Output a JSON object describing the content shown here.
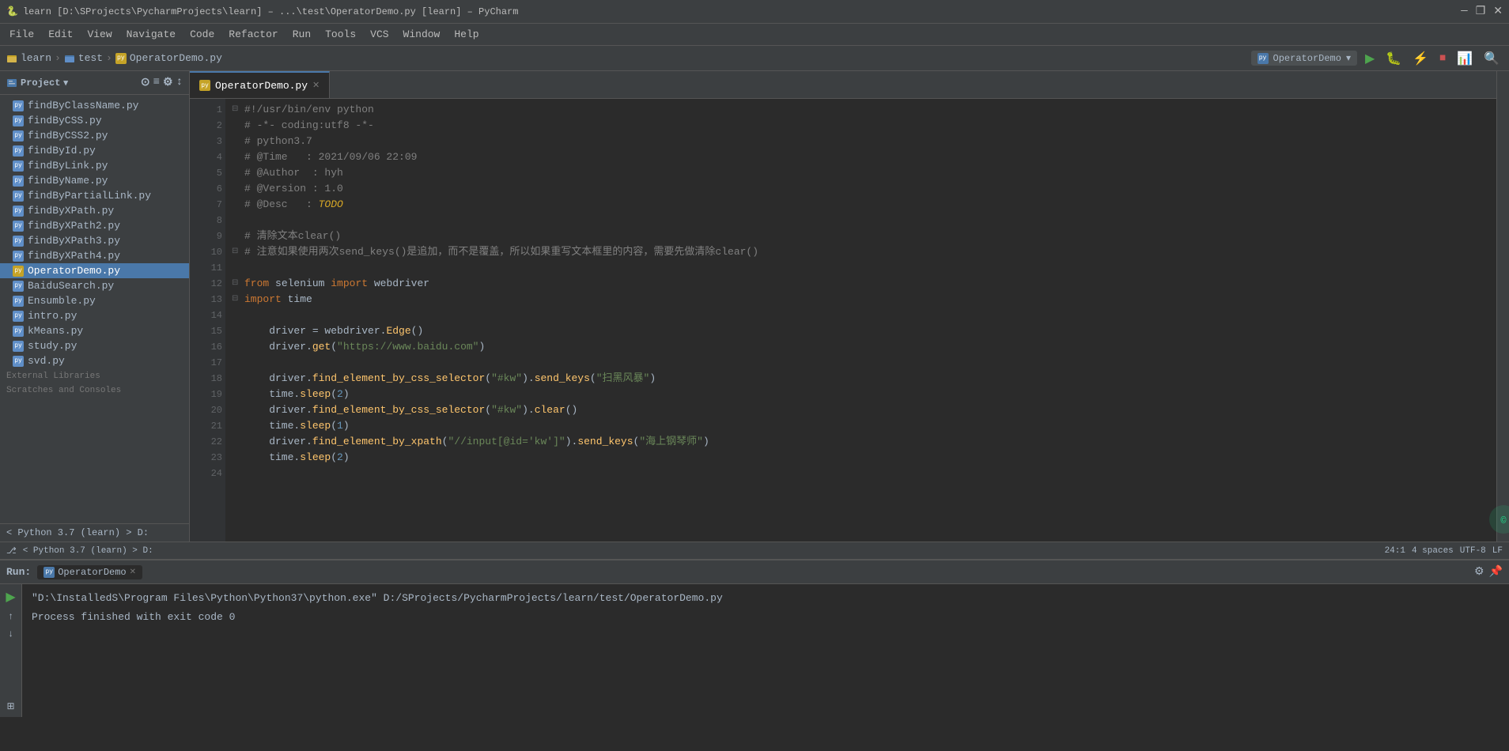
{
  "title_bar": {
    "title": "learn [D:\\SProjects\\PycharmProjects\\learn] – ...\\test\\OperatorDemo.py [learn] – PyCharm",
    "icon": "🐍",
    "controls": [
      "—",
      "❐",
      "✕"
    ]
  },
  "menu": {
    "items": [
      "File",
      "Edit",
      "View",
      "Navigate",
      "Code",
      "Refactor",
      "Run",
      "Tools",
      "VCS",
      "Window",
      "Help"
    ]
  },
  "breadcrumb": {
    "items": [
      "learn",
      "test",
      "OperatorDemo.py"
    ],
    "run_config": "OperatorDemo",
    "toolbar_btns": [
      "▶",
      "🐛",
      "⚡",
      "⏹",
      "📊",
      "🔍"
    ]
  },
  "sidebar": {
    "title": "Project",
    "files": [
      {
        "name": "findByClassName.py",
        "type": "py",
        "active": false
      },
      {
        "name": "findByCSS.py",
        "type": "py",
        "active": false
      },
      {
        "name": "findByCSS2.py",
        "type": "py",
        "active": false
      },
      {
        "name": "findById.py",
        "type": "py",
        "active": false
      },
      {
        "name": "findByLink.py",
        "type": "py",
        "active": false
      },
      {
        "name": "findByName.py",
        "type": "py",
        "active": false
      },
      {
        "name": "findByPartialLink.py",
        "type": "py",
        "active": false
      },
      {
        "name": "findByXPath.py",
        "type": "py",
        "active": false
      },
      {
        "name": "findByXPath2.py",
        "type": "py",
        "active": false
      },
      {
        "name": "findByXPath3.py",
        "type": "py",
        "active": false
      },
      {
        "name": "findByXPath4.py",
        "type": "py",
        "active": false
      },
      {
        "name": "OperatorDemo.py",
        "type": "py_yellow",
        "active": true
      },
      {
        "name": "BaiduSearch.py",
        "type": "py",
        "active": false
      },
      {
        "name": "Ensumble.py",
        "type": "py",
        "active": false
      },
      {
        "name": "intro.py",
        "type": "py",
        "active": false
      },
      {
        "name": "kMeans.py",
        "type": "py",
        "active": false
      },
      {
        "name": "study.py",
        "type": "py",
        "active": false
      },
      {
        "name": "svd.py",
        "type": "py",
        "active": false
      }
    ],
    "sections": [
      {
        "name": "External Libraries"
      },
      {
        "name": "Scratches and Consoles"
      }
    ],
    "python_version": "< Python 3.7 (learn) > D:"
  },
  "editor": {
    "tab_name": "OperatorDemo.py",
    "lines": [
      {
        "num": 1,
        "fold": "⊟",
        "html_class": "shebang",
        "text": "#!/usr/bin/env python"
      },
      {
        "num": 2,
        "fold": "",
        "html_class": "cm",
        "text": "# -*- coding:utf8 -*-"
      },
      {
        "num": 3,
        "fold": "",
        "html_class": "cm",
        "text": "# python3.7"
      },
      {
        "num": 4,
        "fold": "",
        "html_class": "cm",
        "text": "# @Time   : 2021/09/06 22:09"
      },
      {
        "num": 5,
        "fold": "",
        "html_class": "cm",
        "text": "# @Author  : hyh"
      },
      {
        "num": 6,
        "fold": "",
        "html_class": "cm",
        "text": "# @Version : 1.0"
      },
      {
        "num": 7,
        "fold": "",
        "html_class": "cm_todo",
        "text": "# @Desc   : TODO"
      },
      {
        "num": 8,
        "fold": "",
        "html_class": "blank",
        "text": ""
      },
      {
        "num": 9,
        "fold": "",
        "html_class": "cm",
        "text": "# 清除文本clear()"
      },
      {
        "num": 10,
        "fold": "⊟",
        "html_class": "cm_long",
        "text": "# 注意如果使用两次send_keys()是追加，而不是覆盖，所以如果重写文本框里的内容，需要先做清除clear()"
      },
      {
        "num": 11,
        "fold": "",
        "html_class": "blank",
        "text": ""
      },
      {
        "num": 12,
        "fold": "⊟",
        "html_class": "import",
        "text": "from selenium import webdriver"
      },
      {
        "num": 13,
        "fold": "⊟",
        "html_class": "import2",
        "text": "import time"
      },
      {
        "num": 14,
        "fold": "",
        "html_class": "blank",
        "text": ""
      },
      {
        "num": 15,
        "fold": "",
        "html_class": "assign",
        "text": "driver = webdriver.Edge()"
      },
      {
        "num": 16,
        "fold": "",
        "html_class": "call",
        "text": "driver.get(\"https://www.baidu.com\")"
      },
      {
        "num": 17,
        "fold": "",
        "html_class": "blank",
        "text": ""
      },
      {
        "num": 18,
        "fold": "",
        "html_class": "call2",
        "text": "driver.find_element_by_css_selector(\"#kw\").send_keys(\"扫黑风暴\")"
      },
      {
        "num": 19,
        "fold": "",
        "html_class": "call3",
        "text": "time.sleep(2)"
      },
      {
        "num": 20,
        "fold": "",
        "html_class": "call4",
        "text": "driver.find_element_by_css_selector(\"#kw\").clear()"
      },
      {
        "num": 21,
        "fold": "",
        "html_class": "call3",
        "text": "time.sleep(1)"
      },
      {
        "num": 22,
        "fold": "",
        "html_class": "call5",
        "text": "driver.find_element_by_xpath(\"//input[@id='kw']\").send_keys(\"海上钢琴师\")"
      },
      {
        "num": 23,
        "fold": "",
        "html_class": "call3",
        "text": "time.sleep(2)"
      },
      {
        "num": 24,
        "fold": "",
        "html_class": "blank",
        "text": ""
      }
    ]
  },
  "status_bar": {
    "python": "< Python 3.7 (learn) > D:",
    "encoding": "UTF-8",
    "line_sep": "LF",
    "cursor": "24:1",
    "indent": "4 spaces"
  },
  "run_panel": {
    "label": "Run:",
    "tab": "OperatorDemo",
    "cmd": "\"D:\\InstalledS\\Program Files\\Python\\Python37\\python.exe\" D:/SProjects/PycharmProjects/learn/test/OperatorDemo.py",
    "result": "Process finished with exit code 0"
  }
}
